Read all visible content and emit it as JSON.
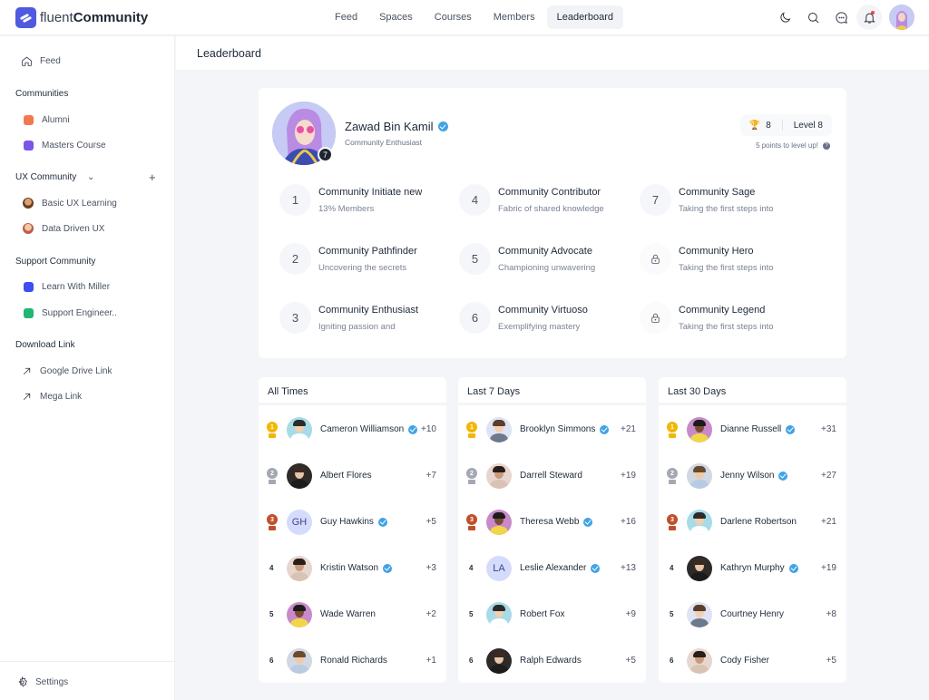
{
  "app": {
    "brand_light": "fluent",
    "brand_bold": "Community",
    "brand_color": "#4f5ae0"
  },
  "topnav": {
    "items": [
      {
        "label": "Feed",
        "active": false
      },
      {
        "label": "Spaces",
        "active": false
      },
      {
        "label": "Courses",
        "active": false
      },
      {
        "label": "Members",
        "active": false
      },
      {
        "label": "Leaderboard",
        "active": true
      }
    ],
    "icons": [
      "moon-icon",
      "search-icon",
      "chat-icon",
      "bell-icon"
    ],
    "notification_dot_color": "#e5484d"
  },
  "sidebar": {
    "feed_label": "Feed",
    "sections": [
      {
        "heading": "Communities",
        "items": [
          {
            "label": "Alumni",
            "color": "#f07a4e"
          },
          {
            "label": "Masters Course",
            "color": "#7b55e8"
          }
        ]
      },
      {
        "heading": "UX Community",
        "items": [
          {
            "label": "Basic UX Learning"
          },
          {
            "label": "Data Driven UX"
          }
        ]
      },
      {
        "heading": "Support Community",
        "items": [
          {
            "label": "Learn With Miller",
            "color": "#3c4ff0"
          },
          {
            "label": "Support Engineer..",
            "color": "#22b573"
          }
        ]
      },
      {
        "heading": "Download Link",
        "items": [
          {
            "label": "Google Drive Link"
          },
          {
            "label": "Mega Link"
          }
        ]
      }
    ],
    "settings_label": "Settings"
  },
  "page": {
    "title": "Leaderboard"
  },
  "profile": {
    "name": "Zawad Bin Kamil",
    "role": "Community Enthusiast",
    "level_badge": "7",
    "trophies": "8",
    "level_label": "Level 8",
    "level_hint": "5 points to level up!",
    "info_glyph": "?"
  },
  "levels": [
    {
      "num": "1",
      "title": "Community Initiate new",
      "desc": "13% Members",
      "locked": false
    },
    {
      "num": "2",
      "title": "Community Pathfinder",
      "desc": "Uncovering the secrets",
      "locked": false
    },
    {
      "num": "3",
      "title": "Community Enthusiast",
      "desc": "Igniting passion and",
      "locked": false
    },
    {
      "num": "4",
      "title": "Community Contributor",
      "desc": "Fabric of shared knowledge",
      "locked": false
    },
    {
      "num": "5",
      "title": "Community Advocate",
      "desc": "Championing unwavering",
      "locked": false
    },
    {
      "num": "6",
      "title": "Community Virtuoso",
      "desc": "Exemplifying mastery",
      "locked": false
    },
    {
      "num": "7",
      "title": "Community Sage",
      "desc": "Taking the first steps into",
      "locked": false
    },
    {
      "num": "",
      "title": "Community Hero",
      "desc": "Taking the first steps into",
      "locked": true
    },
    {
      "num": "",
      "title": "Community Legend",
      "desc": "Taking the first steps into",
      "locked": true
    }
  ],
  "leaderboards": [
    {
      "title": "All Times",
      "rows": [
        {
          "rank": "1",
          "name": "Cameron Williamson",
          "verified": true,
          "points": "+10",
          "initials": ""
        },
        {
          "rank": "2",
          "name": "Albert Flores",
          "verified": false,
          "points": "+7",
          "initials": ""
        },
        {
          "rank": "3",
          "name": "Guy Hawkins",
          "verified": true,
          "points": "+5",
          "initials": "GH"
        },
        {
          "rank": "4",
          "name": "Kristin Watson",
          "verified": true,
          "points": "+3",
          "initials": ""
        },
        {
          "rank": "5",
          "name": "Wade Warren",
          "verified": false,
          "points": "+2",
          "initials": ""
        },
        {
          "rank": "6",
          "name": "Ronald Richards",
          "verified": false,
          "points": "+1",
          "initials": ""
        }
      ]
    },
    {
      "title": "Last 7 Days",
      "rows": [
        {
          "rank": "1",
          "name": "Brooklyn Simmons",
          "verified": true,
          "points": "+21",
          "initials": ""
        },
        {
          "rank": "2",
          "name": "Darrell Steward",
          "verified": false,
          "points": "+19",
          "initials": ""
        },
        {
          "rank": "3",
          "name": "Theresa Webb",
          "verified": true,
          "points": "+16",
          "initials": ""
        },
        {
          "rank": "4",
          "name": "Leslie Alexander",
          "verified": true,
          "points": "+13",
          "initials": "LA"
        },
        {
          "rank": "5",
          "name": "Robert Fox",
          "verified": false,
          "points": "+9",
          "initials": ""
        },
        {
          "rank": "6",
          "name": "Ralph Edwards",
          "verified": false,
          "points": "+5",
          "initials": ""
        }
      ]
    },
    {
      "title": "Last 30 Days",
      "rows": [
        {
          "rank": "1",
          "name": "Dianne Russell",
          "verified": true,
          "points": "+31",
          "initials": ""
        },
        {
          "rank": "2",
          "name": "Jenny Wilson",
          "verified": true,
          "points": "+27",
          "initials": ""
        },
        {
          "rank": "3",
          "name": "Darlene Robertson",
          "verified": false,
          "points": "+21",
          "initials": ""
        },
        {
          "rank": "4",
          "name": "Kathryn Murphy",
          "verified": true,
          "points": "+19",
          "initials": ""
        },
        {
          "rank": "5",
          "name": "Courtney Henry",
          "verified": false,
          "points": "+8",
          "initials": ""
        },
        {
          "rank": "6",
          "name": "Cody Fisher",
          "verified": false,
          "points": "+5",
          "initials": ""
        }
      ]
    }
  ],
  "colors": {
    "gold": "#f2b705",
    "silver": "#a3a8b3",
    "bronze": "#c0502a",
    "verified": "#3fa3e6"
  }
}
